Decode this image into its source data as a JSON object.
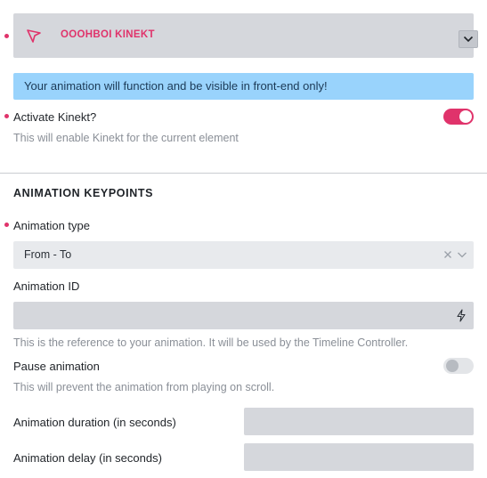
{
  "accordion": {
    "title": "OOOHBOI KINEKT",
    "icon": "cursor-arrow-icon",
    "toggle_icon": "chevron-down-icon"
  },
  "notice": {
    "text": "Your animation will function and be visible in front-end only!"
  },
  "activate": {
    "label": "Activate Kinekt?",
    "description": "This will enable Kinekt for the current element",
    "enabled": true
  },
  "section": {
    "title": "ANIMATION KEYPOINTS"
  },
  "animation_type": {
    "label": "Animation type",
    "value": "From - To"
  },
  "animation_id": {
    "label": "Animation ID",
    "value": "",
    "description": "This is the reference to your animation. It will be used by the Timeline Controller."
  },
  "pause": {
    "label": "Pause animation",
    "description": "This will prevent the animation from playing on scroll.",
    "enabled": false
  },
  "duration": {
    "label": "Animation duration (in seconds)",
    "value": ""
  },
  "delay": {
    "label": "Animation delay (in seconds)",
    "value": ""
  },
  "colors": {
    "accent": "#e0336b",
    "notice_bg": "#99d3fc",
    "panel_bg": "#d5d7dc"
  }
}
